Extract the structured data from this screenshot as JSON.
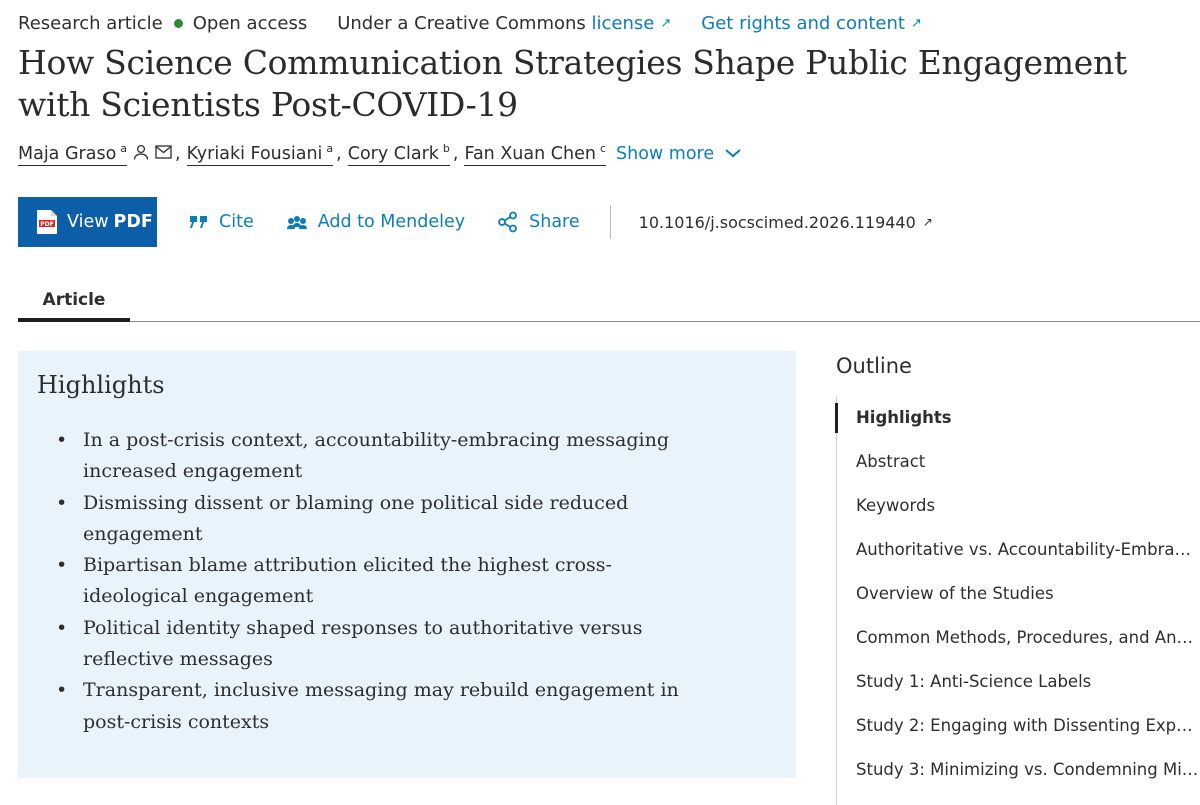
{
  "meta": {
    "article_type": "Research article",
    "open_access": "Open access",
    "license_prefix": "Under a Creative Commons",
    "license_link": "license",
    "rights_link": "Get rights and content",
    "open_access_color": "#2f8a2f",
    "link_color": "#0c7dbb"
  },
  "title": "How Science Communication Strategies Shape Public Engagement with Scientists Post-COVID-19",
  "authors": [
    {
      "name": "Maja Graso",
      "sup": "a"
    },
    {
      "name": "Kyriaki Fousiani",
      "sup": "a"
    },
    {
      "name": "Cory Clark",
      "sup": "b"
    },
    {
      "name": "Fan Xuan Chen",
      "sup": "c"
    }
  ],
  "authors_show_more": "Show more",
  "toolbar": {
    "view_label": "View",
    "pdf_label": "PDF",
    "cite": "Cite",
    "mendeley": "Add to Mendeley",
    "share": "Share",
    "doi": "10.1016/j.socscimed.2026.119440",
    "button_color": "#0c5ea8"
  },
  "tabs": {
    "article": "Article"
  },
  "highlights": {
    "title": "Highlights",
    "items": [
      "In a post-crisis context, accountability-embracing messaging increased engagement",
      "Dismissing dissent or blaming one political side reduced engagement",
      "Bipartisan blame attribution elicited the highest cross-ideological engagement",
      "Political identity shaped responses to authoritative versus reflective messages",
      "Transparent, inclusive messaging may rebuild engagement in post-crisis contexts"
    ],
    "background": "#e9f3fb"
  },
  "outline": {
    "title": "Outline",
    "items": [
      "Highlights",
      "Abstract",
      "Keywords",
      "Authoritative vs. Accountability-Embra…",
      "Overview of the Studies",
      "Common Methods, Procedures, and An…",
      "Study 1: Anti-Science Labels",
      "Study 2: Engaging with Dissenting Expe…",
      "Study 3: Minimizing vs. Condemning Mi…"
    ],
    "active": "Highlights"
  }
}
